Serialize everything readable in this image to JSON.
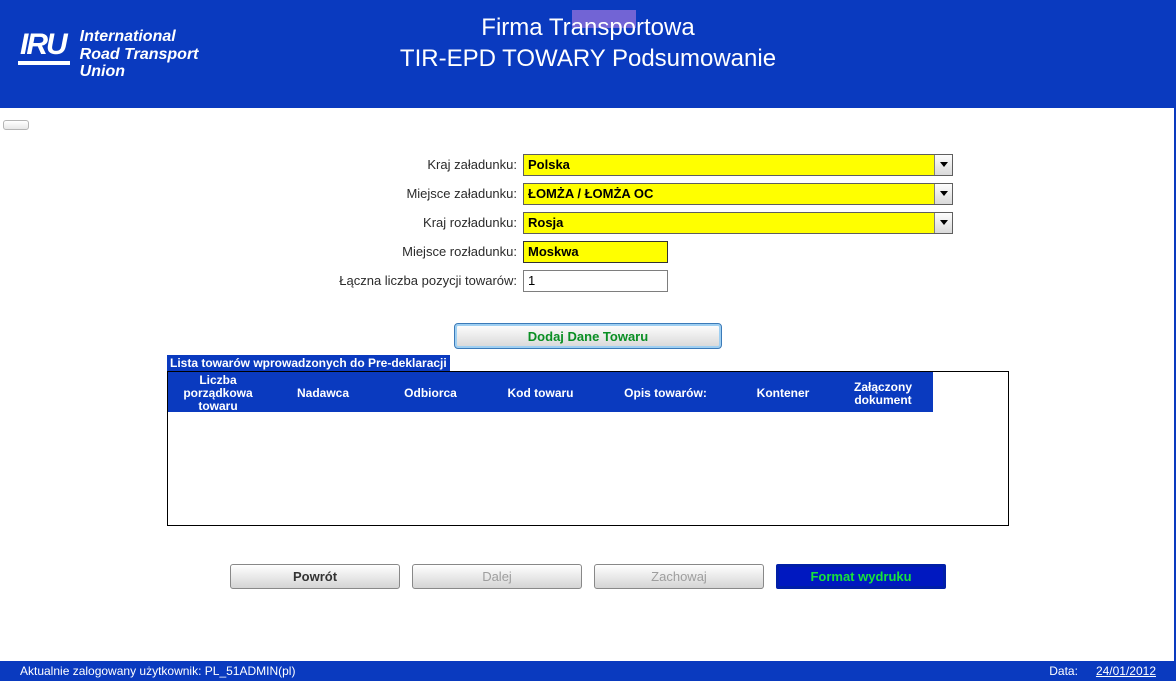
{
  "brand": {
    "iru": "IRU",
    "sub": "International\nRoad Transport\nUnion"
  },
  "header": {
    "line1": "Firma Transportowa",
    "line2": "TIR-EPD TOWARY Podsumowanie"
  },
  "form": {
    "loading_country": {
      "label": "Kraj załadunku:",
      "value": "Polska"
    },
    "loading_place": {
      "label": "Miejsce załadunku:",
      "value": "ŁOMŻA / ŁOMŻA OC"
    },
    "unloading_country": {
      "label": "Kraj rozładunku:",
      "value": "Rosja"
    },
    "unloading_place": {
      "label": "Miejsce rozładunku:",
      "value": "Moskwa"
    },
    "total_items": {
      "label": "Łączna liczba pozycji towarów:",
      "value": "1"
    }
  },
  "add_button": "Dodaj Dane Towaru",
  "list_title": "Lista towarów wprowadzonych do Pre-deklaracji",
  "columns": [
    "Liczba porządkowa towaru",
    "Nadawca",
    "Odbiorca",
    "Kod towaru",
    "Opis towarów:",
    "Kontener",
    "Załączony dokument"
  ],
  "buttons": {
    "back": "Powrót",
    "next": "Dalej",
    "save": "Zachowaj",
    "print": "Format wydruku"
  },
  "footer": {
    "left": "Aktualnie zalogowany użytkownik:   PL_51ADMIN(pl)",
    "date_label": "Data:",
    "date": "24/01/2012"
  }
}
